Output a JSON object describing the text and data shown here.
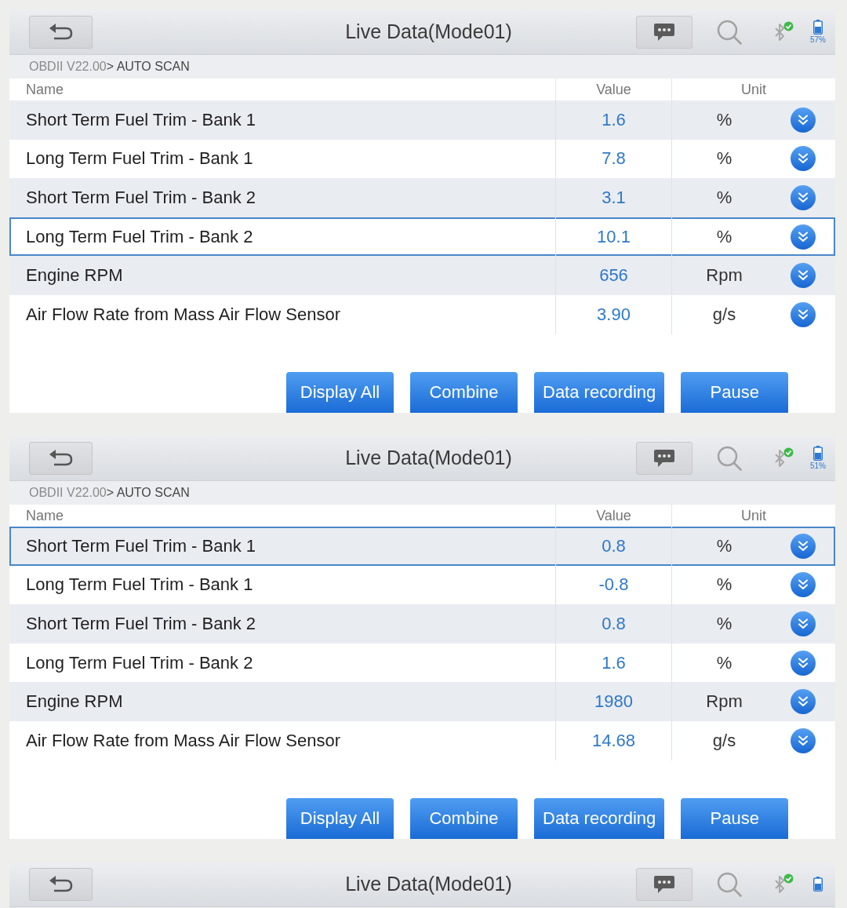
{
  "screens": [
    {
      "header": {
        "title": "Live Data(Mode01)",
        "battery": "57%"
      },
      "breadcrumb": [
        {
          "label": "OBDII V22.00",
          "current": false
        },
        {
          "label": "> AUTO SCAN",
          "current": true
        }
      ],
      "columns": [
        "Name",
        "Value",
        "Unit"
      ],
      "rows": [
        {
          "name": "Short Term Fuel Trim - Bank 1",
          "value": "1.6",
          "unit": "%",
          "selected": false
        },
        {
          "name": "Long Term Fuel Trim - Bank 1",
          "value": "7.8",
          "unit": "%",
          "selected": false
        },
        {
          "name": "Short Term Fuel Trim - Bank 2",
          "value": "3.1",
          "unit": "%",
          "selected": false
        },
        {
          "name": "Long Term Fuel Trim - Bank 2",
          "value": "10.1",
          "unit": "%",
          "selected": true
        },
        {
          "name": "Engine RPM",
          "value": "656",
          "unit": "Rpm",
          "selected": false
        },
        {
          "name": "Air Flow Rate from Mass Air Flow Sensor",
          "value": "3.90",
          "unit": "g/s",
          "selected": false
        }
      ],
      "buttons": [
        "Display All",
        "Combine",
        "Data recording",
        "Pause"
      ]
    },
    {
      "header": {
        "title": "Live Data(Mode01)",
        "battery": "51%"
      },
      "breadcrumb": [
        {
          "label": "OBDII V22.00",
          "current": false
        },
        {
          "label": "> AUTO SCAN",
          "current": true
        }
      ],
      "columns": [
        "Name",
        "Value",
        "Unit"
      ],
      "rows": [
        {
          "name": "Short Term Fuel Trim - Bank 1",
          "value": "0.8",
          "unit": "%",
          "selected": true
        },
        {
          "name": "Long Term Fuel Trim - Bank 1",
          "value": "-0.8",
          "unit": "%",
          "selected": false
        },
        {
          "name": "Short Term Fuel Trim - Bank 2",
          "value": "0.8",
          "unit": "%",
          "selected": false
        },
        {
          "name": "Long Term Fuel Trim - Bank 2",
          "value": "1.6",
          "unit": "%",
          "selected": false
        },
        {
          "name": "Engine RPM",
          "value": "1980",
          "unit": "Rpm",
          "selected": false
        },
        {
          "name": "Air Flow Rate from Mass Air Flow Sensor",
          "value": "14.68",
          "unit": "g/s",
          "selected": false
        }
      ],
      "buttons": [
        "Display All",
        "Combine",
        "Data recording",
        "Pause"
      ]
    },
    {
      "header": {
        "title": "Live Data(Mode01)"
      }
    }
  ]
}
